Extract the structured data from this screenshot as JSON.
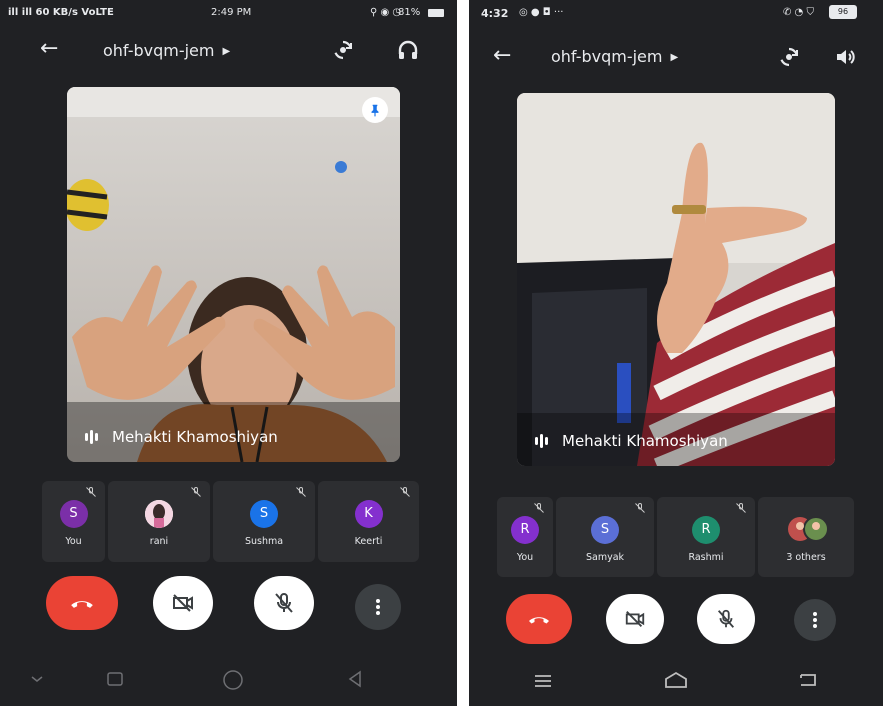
{
  "left_phone": {
    "status": {
      "left": "ill ill 60 KB/s VoLTE",
      "time": "2:49 PM",
      "right": "81%"
    },
    "meeting_code": "ohf-bvqm-jem",
    "main_speaker": "Mehakti Khamoshiyan",
    "participants": [
      {
        "initial": "S",
        "label": "You",
        "color": "#7b2fa8"
      },
      {
        "initial": "",
        "label": "rani",
        "color": "#ffffff"
      },
      {
        "initial": "S",
        "label": "Sushma",
        "color": "#1a73e8"
      },
      {
        "initial": "K",
        "label": "Keerti",
        "color": "#8430ce"
      }
    ],
    "icons": {
      "back": "back-arrow-icon",
      "switch_camera": "switch-camera-icon",
      "audio": "headphones-icon",
      "pin": "pin-icon"
    }
  },
  "right_phone": {
    "status": {
      "left": "4:32",
      "right": "96"
    },
    "meeting_code": "ohf-bvqm-jem",
    "main_speaker": "Mehakti Khamoshiyan",
    "participants": [
      {
        "initial": "R",
        "label": "You",
        "color": "#8430ce"
      },
      {
        "initial": "S",
        "label": "Samyak",
        "color": "#5b6fd6"
      },
      {
        "initial": "R",
        "label": "Rashmi",
        "color": "#1e8e6e"
      },
      {
        "initial": "",
        "label": "3 others",
        "color": "#c0504d"
      }
    ],
    "icons": {
      "back": "back-arrow-icon",
      "switch_camera": "switch-camera-icon",
      "audio": "speaker-icon"
    }
  },
  "colors": {
    "end_call": "#ea4335",
    "background": "#202124",
    "tile": "#2d2e31"
  }
}
